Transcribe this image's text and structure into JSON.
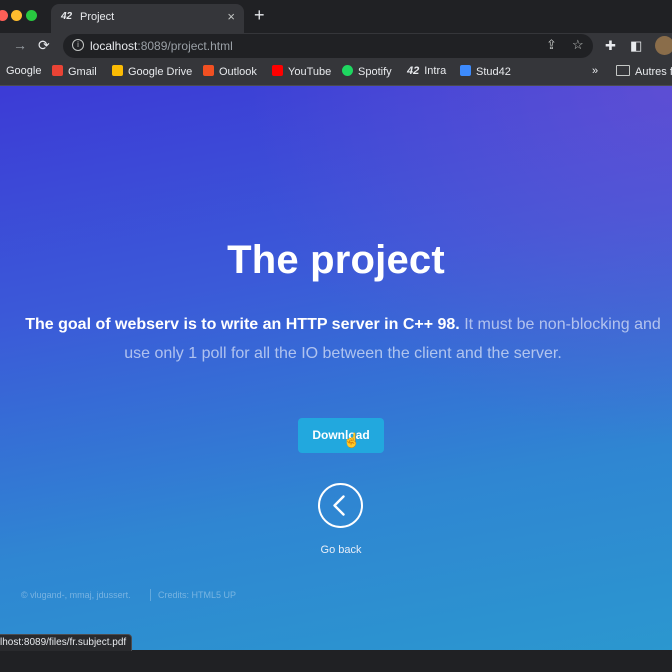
{
  "browser": {
    "tab": {
      "title": "Project",
      "favicon_text": "42",
      "close_glyph": "×"
    },
    "new_tab_glyph": "+",
    "address": {
      "host": "localhost",
      "path": ":8089/project.html"
    },
    "bookmarks": [
      {
        "label": "Google",
        "icon": "google-icon",
        "color": "#4285f4"
      },
      {
        "label": "Gmail",
        "icon": "gmail-icon",
        "color": "#ea4335"
      },
      {
        "label": "Google Drive",
        "icon": "google-drive-icon",
        "color": "#fbbc04"
      },
      {
        "label": "Outlook",
        "icon": "outlook-icon",
        "color": "#f25022"
      },
      {
        "label": "YouTube",
        "icon": "youtube-icon",
        "color": "#ff0000"
      },
      {
        "label": "Spotify",
        "icon": "spotify-icon",
        "color": "#1ed760"
      },
      {
        "label": "Intra",
        "icon": "intra-icon",
        "color": "#e8eaed"
      },
      {
        "label": "Stud42",
        "icon": "stud42-icon",
        "color": "#3d8bfd"
      }
    ],
    "bookmarks_more": "»",
    "other_bookmarks": "Autres fa",
    "status_url": "lhost:8089/files/fr.subject.pdf"
  },
  "page": {
    "title": "The project",
    "intro_bold": "The goal of webserv is to write an HTTP server in C++ 98.",
    "intro_rest": " It must be non-blocking and use only 1 poll for all the IO between the client and the server.",
    "download_label": "Download",
    "back_label": "Go back",
    "footer_authors": "© vlugand-, mmaj, jdussert.",
    "footer_credits": "Credits: HTML5 UP"
  }
}
